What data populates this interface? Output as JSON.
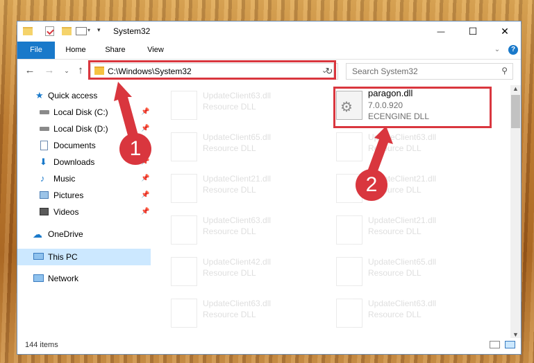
{
  "window": {
    "title": "System32",
    "controls": {
      "minimize": "—",
      "maximize": "☐",
      "close": "✕"
    }
  },
  "ribbon": {
    "tabs": [
      "File",
      "Home",
      "Share",
      "View"
    ],
    "expand_icon": "chevron-down-icon",
    "help_icon": "help-icon"
  },
  "nav": {
    "address": "C:\\Windows\\System32",
    "search_placeholder": "Search System32"
  },
  "sidebar": {
    "items": [
      {
        "label": "Quick access",
        "icon": "star-icon",
        "pinned": false
      },
      {
        "label": "Local Disk (C:)",
        "icon": "drive-icon",
        "pinned": true
      },
      {
        "label": "Local Disk (D:)",
        "icon": "drive-icon",
        "pinned": true
      },
      {
        "label": "Documents",
        "icon": "document-icon",
        "pinned": true
      },
      {
        "label": "Downloads",
        "icon": "download-icon",
        "pinned": true
      },
      {
        "label": "Music",
        "icon": "music-icon",
        "pinned": true
      },
      {
        "label": "Pictures",
        "icon": "picture-icon",
        "pinned": true
      },
      {
        "label": "Videos",
        "icon": "video-icon",
        "pinned": true
      },
      {
        "label": "OneDrive",
        "icon": "cloud-icon",
        "pinned": false
      },
      {
        "label": "This PC",
        "icon": "computer-icon",
        "pinned": false
      },
      {
        "label": "Network",
        "icon": "network-icon",
        "pinned": false
      }
    ],
    "selected": "This PC"
  },
  "files": {
    "highlighted": {
      "name": "paragon.dll",
      "version": "7.0.0.920",
      "description": "ECENGINE DLL"
    },
    "left_column": [
      {
        "name": "UpdateClient63.dll",
        "description": "Resource DLL"
      },
      {
        "name": "UpdateClient65.dll",
        "description": "Resource DLL"
      },
      {
        "name": "UpdateClient21.dll",
        "description": "Resource DLL"
      },
      {
        "name": "UpdateClient63.dll",
        "description": "Resource DLL"
      },
      {
        "name": "UpdateClient42.dll",
        "description": "Resource DLL"
      },
      {
        "name": "UpdateClient63.dll",
        "description": "Resource DLL"
      }
    ],
    "right_column": [
      {
        "name": "UpdateClient63.dll",
        "description": "Resource DLL"
      },
      {
        "name": "UpdateClient21.dll",
        "description": "Resource DLL"
      },
      {
        "name": "UpdateClient21.dll",
        "description": "Resource DLL"
      },
      {
        "name": "UpdateClient65.dll",
        "description": "Resource DLL"
      },
      {
        "name": "UpdateClient63.dll",
        "description": "Resource DLL"
      }
    ]
  },
  "status": {
    "item_count": "144 items"
  },
  "annotations": {
    "step1": "1",
    "step2": "2",
    "color": "#d9363e"
  }
}
